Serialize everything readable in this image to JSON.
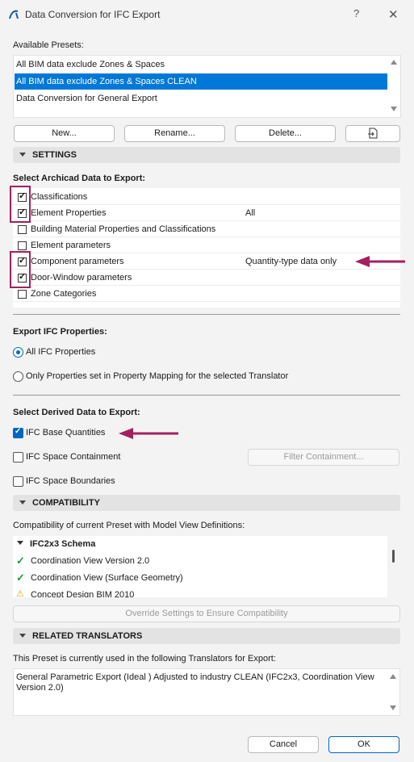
{
  "window": {
    "title": "Data Conversion for IFC Export",
    "help": "?",
    "close": "✕"
  },
  "presets": {
    "label": "Available Presets:",
    "items": [
      "All BIM data exclude Zones & Spaces",
      "All BIM data exclude Zones & Spaces CLEAN",
      "Data Conversion for General Export"
    ],
    "selected_index": 1,
    "buttons": {
      "new": "New...",
      "rename": "Rename...",
      "delete": "Delete..."
    }
  },
  "settings": {
    "header": "SETTINGS",
    "archicad_label": "Select Archicad Data to Export:",
    "archicad_items": [
      {
        "label": "Classifications",
        "checked": true,
        "value": ""
      },
      {
        "label": "Element Properties",
        "checked": true,
        "value": "All"
      },
      {
        "label": "Building Material Properties and Classifications",
        "checked": false,
        "value": ""
      },
      {
        "label": "Element parameters",
        "checked": false,
        "value": ""
      },
      {
        "label": "Component parameters",
        "checked": true,
        "value": "Quantity-type data only"
      },
      {
        "label": "Door-Window parameters",
        "checked": true,
        "value": ""
      },
      {
        "label": "Zone Categories",
        "checked": false,
        "value": ""
      }
    ],
    "ifc_props_label": "Export IFC Properties:",
    "ifc_props_options": [
      "All IFC Properties",
      "Only Properties set in Property Mapping for the selected Translator"
    ],
    "ifc_props_selected": 0,
    "derived_label": "Select Derived Data to Export:",
    "derived_items": [
      {
        "label": "IFC Base Quantities",
        "checked": true
      },
      {
        "label": "IFC Space Containment",
        "checked": false
      },
      {
        "label": "IFC Space Boundaries",
        "checked": false
      }
    ],
    "filter_button": "Filter Containment..."
  },
  "compatibility": {
    "header": "COMPATIBILITY",
    "label": "Compatibility of current Preset with Model View Definitions:",
    "schema": "IFC2x3 Schema",
    "items": [
      {
        "label": "Coordination View Version 2.0",
        "status": "ok"
      },
      {
        "label": "Coordination View (Surface Geometry)",
        "status": "ok"
      },
      {
        "label": "Concept Design BIM 2010",
        "status": "warning"
      }
    ],
    "override_button": "Override Settings to Ensure Compatibility"
  },
  "translators": {
    "header": "RELATED TRANSLATORS",
    "label": "This Preset is currently used in the following Translators for Export:",
    "text": "General Parametric Export (Ideal ) Adjusted to industry CLEAN (IFC2x3, Coordination View Version 2.0)"
  },
  "footer": {
    "cancel": "Cancel",
    "ok": "OK"
  },
  "colors": {
    "accent": "#0078d7",
    "highlight": "#a4205e",
    "ok_green": "#1a9c3c"
  }
}
